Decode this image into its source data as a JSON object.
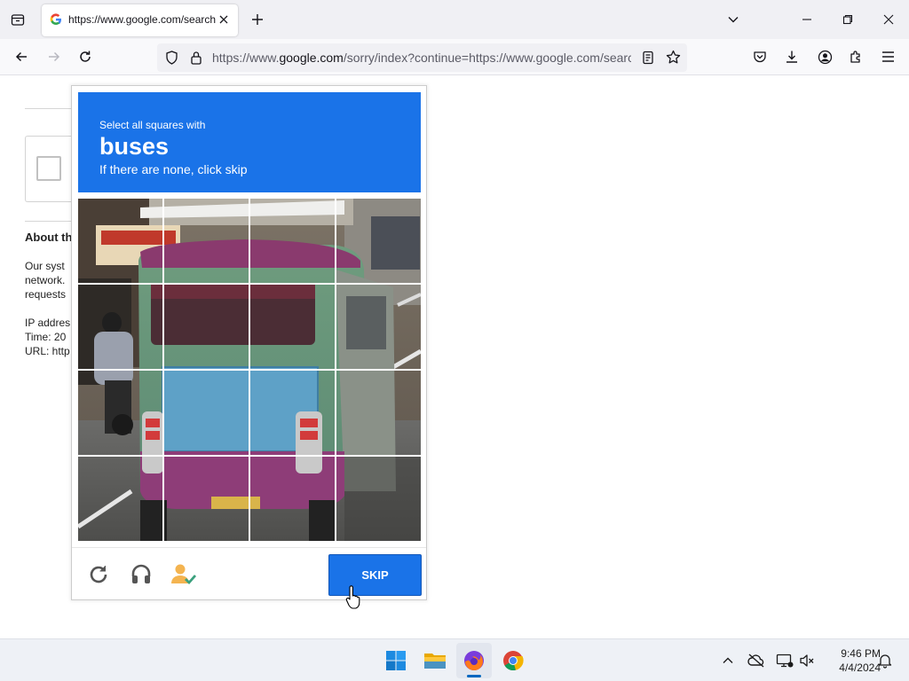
{
  "browser": {
    "tab": {
      "title": "https://www.google.com/search"
    },
    "url": {
      "prefix": "https://www.",
      "host": "google.com",
      "rest": "/sorry/index?continue=https://www.google.com/search"
    }
  },
  "page_behind": {
    "about_heading": "About th",
    "about_lines": [
      "Our syst",
      "network.",
      "requests"
    ],
    "ip_label": "IP addres",
    "time_label": "Time: 20",
    "url_label": "URL: http"
  },
  "captcha": {
    "instruction": "Select all squares with",
    "target": "buses",
    "hint": "If there are none, click skip",
    "skip_label": "SKIP",
    "grid": {
      "rows": 4,
      "cols": 4
    },
    "colors": {
      "accent": "#1a73e8"
    },
    "icons": [
      "reload-icon",
      "audio-icon",
      "info-icon"
    ]
  },
  "taskbar": {
    "apps": [
      "windows-start-icon",
      "file-explorer-icon",
      "firefox-icon",
      "chrome-icon"
    ],
    "time": "9:46 PM",
    "date": "4/4/2024"
  }
}
